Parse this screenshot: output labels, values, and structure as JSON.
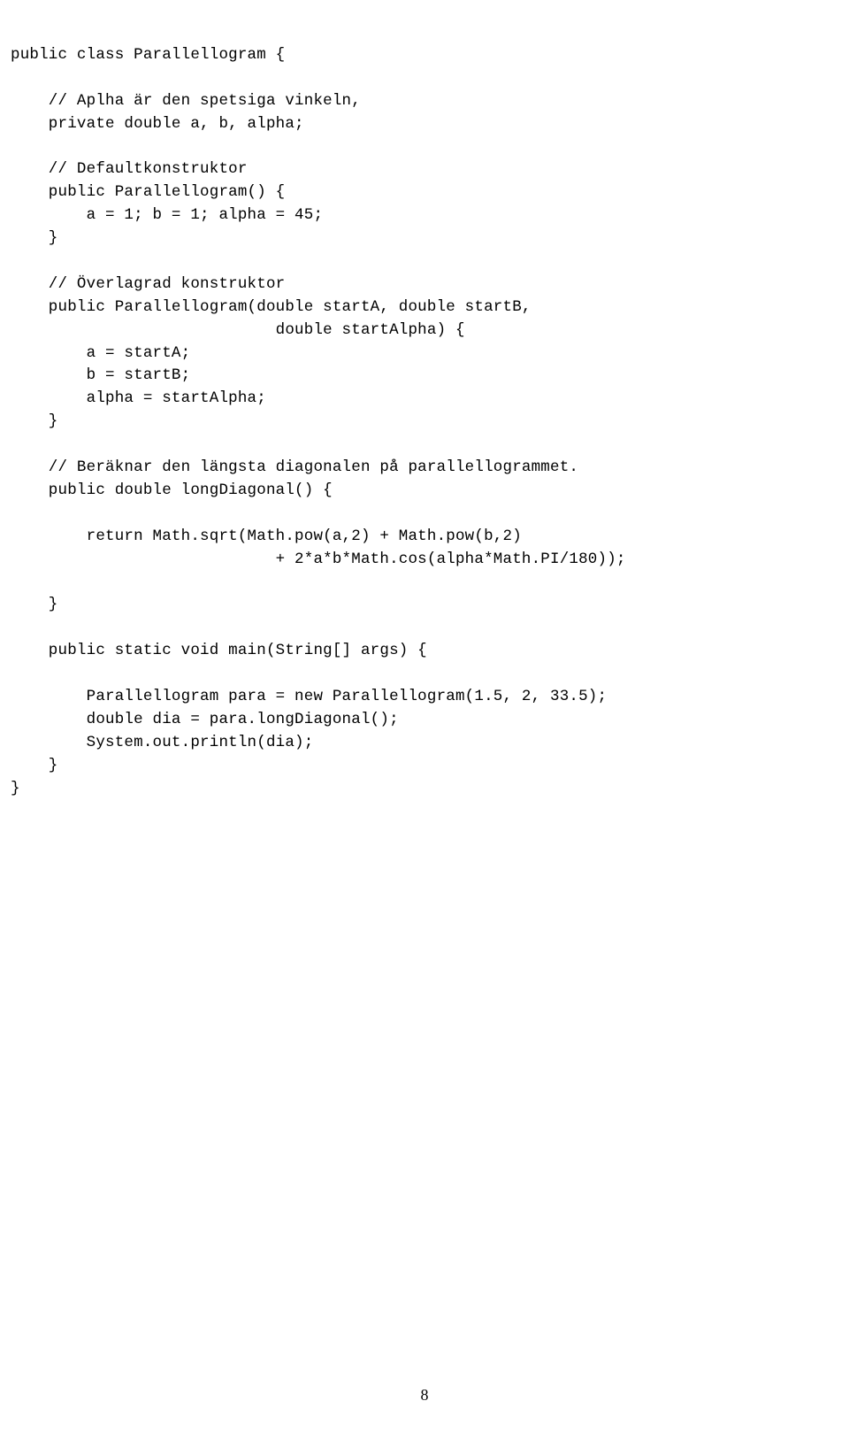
{
  "code": {
    "lines": [
      "public class Parallellogram {",
      "",
      "    // Aplha är den spetsiga vinkeln,",
      "    private double a, b, alpha;",
      "",
      "    // Defaultkonstruktor",
      "    public Parallellogram() {",
      "        a = 1; b = 1; alpha = 45;",
      "    }",
      "",
      "    // Överlagrad konstruktor",
      "    public Parallellogram(double startA, double startB,",
      "                            double startAlpha) {",
      "        a = startA;",
      "        b = startB;",
      "        alpha = startAlpha;",
      "    }",
      "",
      "    // Beräknar den längsta diagonalen på parallellogrammet.",
      "    public double longDiagonal() {",
      "",
      "        return Math.sqrt(Math.pow(a,2) + Math.pow(b,2)",
      "                            + 2*a*b*Math.cos(alpha*Math.PI/180));",
      "",
      "    }",
      "",
      "    public static void main(String[] args) {",
      "",
      "        Parallellogram para = new Parallellogram(1.5, 2, 33.5);",
      "        double dia = para.longDiagonal();",
      "        System.out.println(dia);",
      "    }",
      "}"
    ]
  },
  "page_number": "8"
}
